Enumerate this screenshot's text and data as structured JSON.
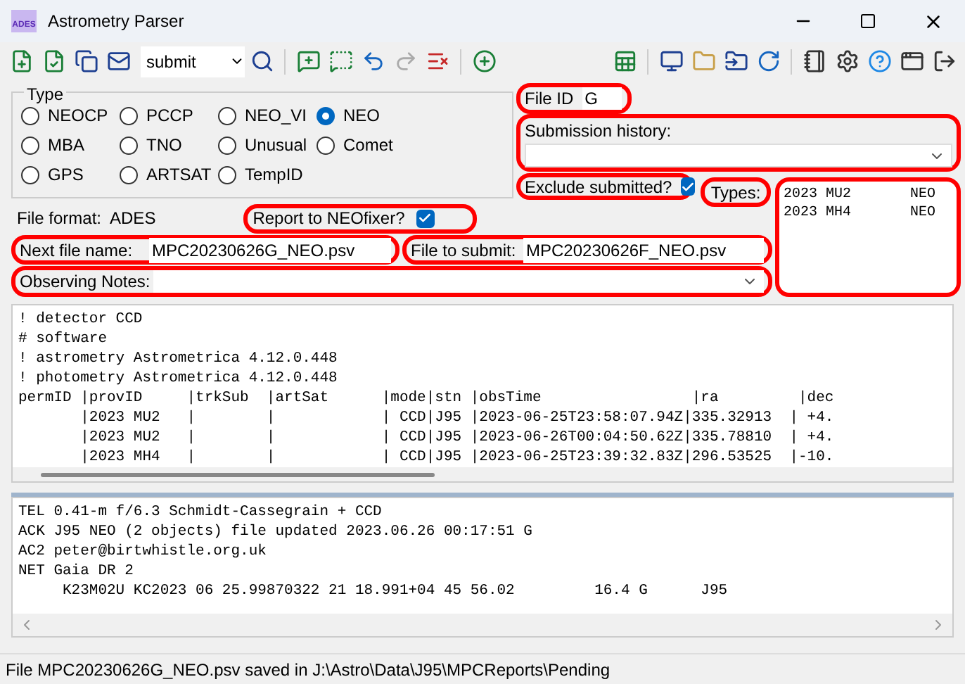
{
  "window": {
    "title": "Astrometry Parser",
    "app_badge": "ADES"
  },
  "toolbar": {
    "mode": "submit"
  },
  "type_group": {
    "title": "Type",
    "options": [
      {
        "label": "NEOCP",
        "selected": false
      },
      {
        "label": "PCCP",
        "selected": false
      },
      {
        "label": "NEO_VI",
        "selected": false
      },
      {
        "label": "NEO",
        "selected": true
      },
      {
        "label": "MBA",
        "selected": false
      },
      {
        "label": "TNO",
        "selected": false
      },
      {
        "label": "Unusual",
        "selected": false
      },
      {
        "label": "Comet",
        "selected": false
      },
      {
        "label": "GPS",
        "selected": false
      },
      {
        "label": "ARTSAT",
        "selected": false
      },
      {
        "label": "TempID",
        "selected": false
      }
    ]
  },
  "file_id": {
    "label": "File ID",
    "value": "G"
  },
  "submission_history": {
    "label": "Submission history:"
  },
  "exclude_submitted": {
    "label": "Exclude submitted?",
    "checked": true
  },
  "types": {
    "label": "Types:",
    "rows": [
      "2023 MU2       NEO",
      "2023 MH4       NEO"
    ]
  },
  "file_format": {
    "label": "File format:",
    "value": "ADES"
  },
  "report_neofixer": {
    "label": "Report to NEOfixer?",
    "checked": true
  },
  "next_file": {
    "label": "Next file name:",
    "value": "MPC20230626G_NEO.psv"
  },
  "file_to_submit": {
    "label": "File to submit:",
    "value": "MPC20230626F_NEO.psv"
  },
  "observing_notes": {
    "label": "Observing Notes:"
  },
  "ades_text": [
    "! detector CCD",
    "# software",
    "! astrometry Astrometrica 4.12.0.448",
    "! photometry Astrometrica 4.12.0.448",
    "permID |provID     |trkSub  |artSat      |mode|stn |obsTime                 |ra         |dec",
    "       |2023 MU2   |        |            | CCD|J95 |2023-06-25T23:58:07.94Z|335.32913  | +4.",
    "       |2023 MU2   |        |            | CCD|J95 |2023-06-26T00:04:50.62Z|335.78810  | +4.",
    "       |2023 MH4   |        |            | CCD|J95 |2023-06-25T23:39:32.83Z|296.53525  |-10."
  ],
  "mpc_text": [
    "TEL 0.41-m f/6.3 Schmidt-Cassegrain + CCD",
    "ACK J95 NEO (2 objects) file updated 2023.06.26 00:17:51 G",
    "AC2 peter@birtwhistle.org.uk",
    "NET Gaia DR 2",
    "     K23M02U KC2023 06 25.99870322 21 18.991+04 45 56.02         16.4 G      J95"
  ],
  "status_bar": "File MPC20230626G_NEO.psv saved in J:\\Astro\\Data\\J95\\MPCReports\\Pending"
}
